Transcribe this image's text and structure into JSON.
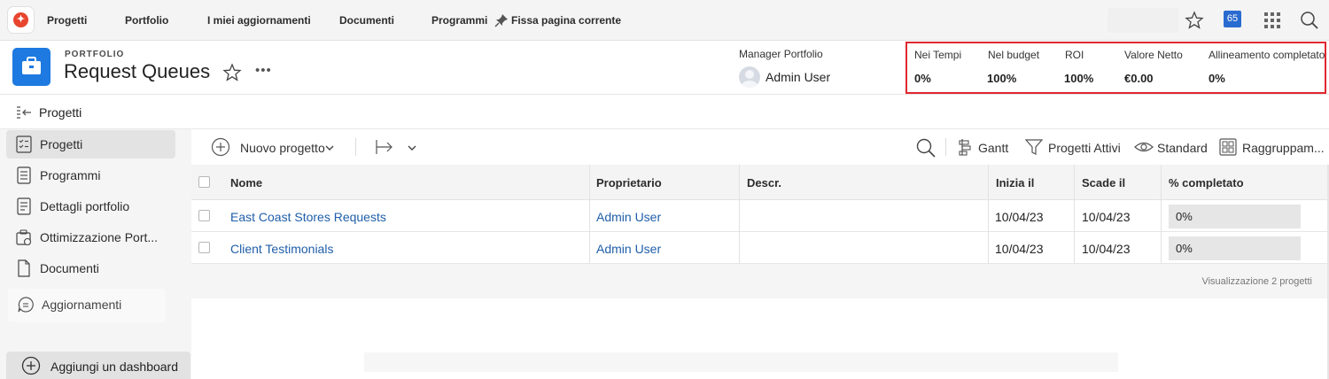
{
  "topnav": {
    "items": [
      "Progetti",
      "Portfolio",
      "I miei aggiornamenti",
      "Documenti",
      "Programmi"
    ],
    "pin_label": "Fissa pagina corrente",
    "badge_count": "65",
    "icons": [
      "app-logo-icon",
      "pin-icon",
      "star-icon",
      "notifications-badge",
      "app-grid-icon",
      "search-icon"
    ]
  },
  "header": {
    "eyebrow": "PORTFOLIO",
    "title": "Request Queues",
    "more": "•••",
    "manager_label": "Manager Portfolio",
    "manager_name": "Admin User"
  },
  "metrics": [
    {
      "label": "Nei Tempi",
      "value": "0%"
    },
    {
      "label": "Nel budget",
      "value": "100%"
    },
    {
      "label": "ROI",
      "value": "100%"
    },
    {
      "label": "Valore Netto",
      "value": "€0.00"
    },
    {
      "label": "Allineamento completato",
      "value": "0%"
    }
  ],
  "sidebar": {
    "header_label": "Progetti",
    "items": [
      {
        "label": "Progetti",
        "icon": "projects-icon",
        "active": true
      },
      {
        "label": "Programmi",
        "icon": "programs-icon",
        "active": false
      },
      {
        "label": "Dettagli portfolio",
        "icon": "details-icon",
        "active": false
      },
      {
        "label": "Ottimizzazione Port...",
        "icon": "optimization-icon",
        "active": false
      },
      {
        "label": "Documenti",
        "icon": "document-icon",
        "active": false
      },
      {
        "label": "Aggiornamenti",
        "icon": "updates-icon",
        "active": false
      }
    ],
    "add_dashboard": "Aggiungi un dashboard"
  },
  "toolbar": {
    "new_project": "Nuovo progetto",
    "gantt": "Gantt",
    "filter": "Progetti Attivi",
    "view": "Standard",
    "group": "Raggruppam..."
  },
  "table": {
    "columns": [
      "Nome",
      "Proprietario",
      "Descr.",
      "Inizia il",
      "Scade il",
      "% completato"
    ],
    "rows": [
      {
        "name": "East Coast Stores Requests",
        "owner": "Admin User",
        "descr": "",
        "start": "10/04/23",
        "due": "10/04/23",
        "percent": "0%",
        "percent_value": 0
      },
      {
        "name": "Client Testimonials",
        "owner": "Admin User",
        "descr": "",
        "start": "10/04/23",
        "due": "10/04/23",
        "percent": "0%",
        "percent_value": 0
      }
    ],
    "footer": "Visualizzazione 2 progetti"
  },
  "colors": {
    "accent": "#1e7ae0",
    "link": "#1f5ea8",
    "highlight_border": "#e0282f",
    "badge": "#2a6bcf"
  }
}
